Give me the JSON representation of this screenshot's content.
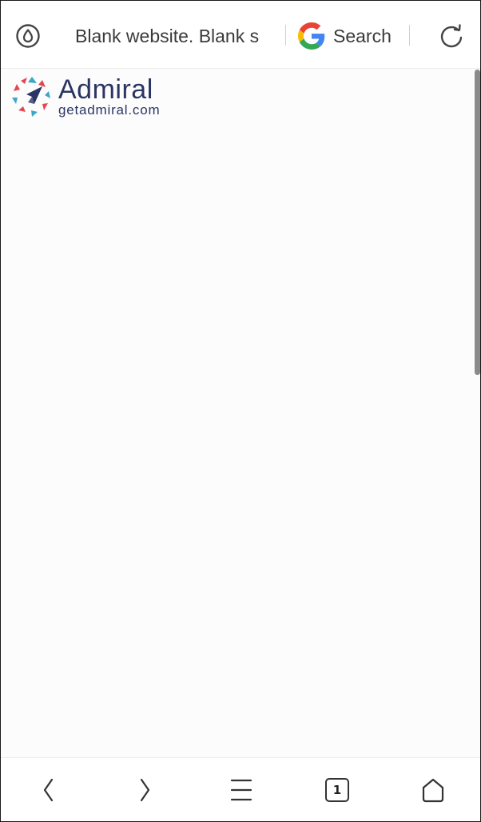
{
  "address_bar": {
    "page_title": "Blank website. Blank s",
    "search_label": "Search",
    "icons": {
      "privacy": "ad-block-shield-icon",
      "search_engine": "google-icon",
      "reload": "reload-icon"
    }
  },
  "content": {
    "logo": {
      "brand": "Admiral",
      "domain": "getadmiral.com"
    }
  },
  "bottom_nav": {
    "tab_count": "1",
    "icons": {
      "back": "chevron-left-icon",
      "forward": "chevron-right-icon",
      "menu": "hamburger-menu-icon",
      "tabs": "tabs-icon",
      "home": "home-icon"
    }
  },
  "colors": {
    "logo_navy": "#2a3563",
    "logo_red": "#e04a4f",
    "logo_teal": "#3aa6c8",
    "icon_gray": "#333333"
  }
}
